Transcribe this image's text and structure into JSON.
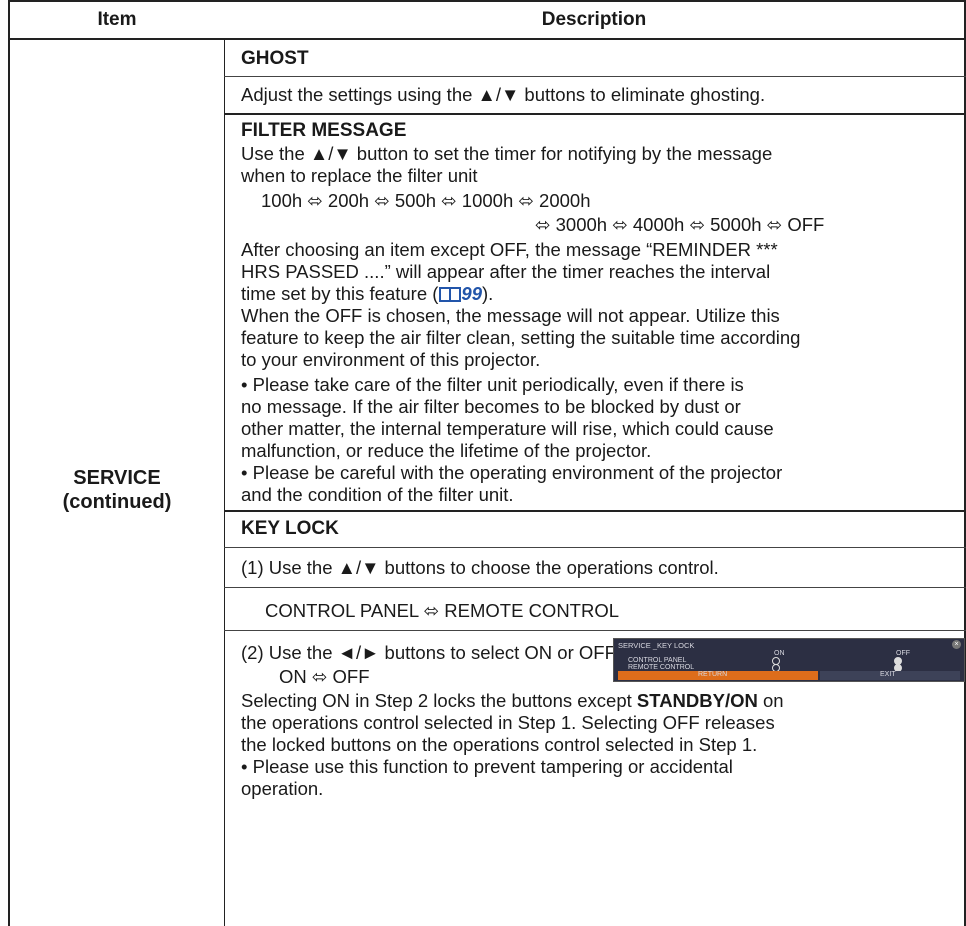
{
  "table": {
    "headers": {
      "item": "Item",
      "description": "Description"
    },
    "item_label_line1": "SERVICE",
    "item_label_line2": "(continued)"
  },
  "ghost": {
    "title": "GHOST",
    "text": "Adjust the settings using the ▲/▼ buttons to eliminate ghosting."
  },
  "filter": {
    "title": "FILTER MESSAGE",
    "intro_line1": "Use the ▲/▼ button to set the timer for notifying by the message",
    "intro_line2": "when to replace the filter unit",
    "options_line1": "100h ⬄ 200h ⬄ 500h ⬄ 1000h ⬄ 2000h",
    "options_line2": "⬄ 3000h ⬄ 4000h ⬄ 5000h ⬄ OFF",
    "after_line1": "After choosing an item except OFF, the message “REMINDER ***",
    "after_line2": "HRS PASSED ....” will appear after the timer reaches the interval",
    "after_line3a": "time set by this feature (",
    "after_line3_ref": "99",
    "after_line3b": ").",
    "off_line1": "When the OFF is chosen, the message will not appear. Utilize this",
    "off_line2": "feature to keep the air filter clean, setting the suitable time according",
    "off_line3": "to your environment of this projector.",
    "note1_line1": "• Please take care of the filter unit periodically, even if there is",
    "note1_line2": "no message. If the air filter becomes to be blocked by dust or",
    "note1_line3": "other matter, the internal temperature will rise, which could cause",
    "note1_line4": "malfunction, or reduce the lifetime of the projector.",
    "note2_line1": "• Please be careful with the operating environment of the projector",
    "note2_line2": "and the condition of the filter unit."
  },
  "keylock": {
    "title": "KEY LOCK",
    "step1": "(1) Use the ▲/▼ buttons to choose the operations control.",
    "step1_options": "CONTROL PANEL ⬄ REMOTE CONTROL",
    "step2": "(2) Use the ◄/► buttons to select ON or OFF.",
    "step2_options": "ON ⬄ OFF",
    "desc_line1a": "Selecting ON in Step 2 locks the buttons except ",
    "desc_line1_bold": "STANDBY/ON",
    "desc_line1b": " on",
    "desc_line2": "the operations control selected in Step 1. Selecting OFF releases",
    "desc_line3": "the locked buttons on the operations control selected in Step 1.",
    "note_line1": "• Please use this function to prevent tampering or accidental",
    "note_line2": "operation."
  },
  "mini_screen": {
    "title": "SERVICE _KEY LOCK",
    "col_on": "ON",
    "col_off": "OFF",
    "row1": "CONTROL PANEL",
    "row2": "REMOTE CONTROL",
    "return_label": "RETURN",
    "exit_label": "EXIT"
  },
  "colors": {
    "ref_blue": "#2255aa",
    "menu_orange": "#dd6d1b",
    "menu_bg": "#2c2f43"
  }
}
